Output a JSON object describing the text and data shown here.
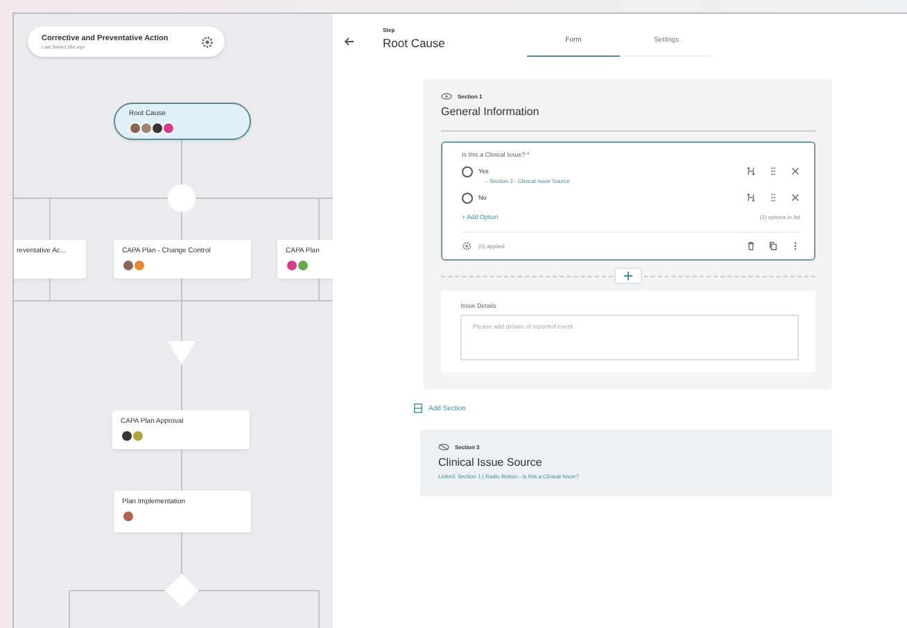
{
  "flow": {
    "title": "Corrective and Preventative Action",
    "subtitle": "Last Saved 18d ago",
    "nodes": [
      {
        "label": "Root Cause",
        "selected": true,
        "avatars": [
          {
            "color": "#8a6552"
          },
          {
            "color": "#9c8470"
          },
          {
            "color": "#3a3330"
          },
          {
            "color": "#d8398a"
          }
        ]
      },
      {
        "label": "reventative Ac...",
        "selected": false
      },
      {
        "label": "CAPA Plan - Change Control",
        "selected": false,
        "avatars": [
          {
            "color": "#8a6552"
          },
          {
            "color": "#e8892c"
          }
        ]
      },
      {
        "label": "CAPA Plan",
        "selected": false,
        "avatars": [
          {
            "color": "#d8398a"
          },
          {
            "color": "#6aa84f"
          }
        ]
      },
      {
        "label": "CAPA Plan Approval",
        "selected": false,
        "avatars": [
          {
            "color": "#3a3330"
          },
          {
            "color": "#b5a53f"
          }
        ]
      },
      {
        "label": "Plan Implementation",
        "selected": false,
        "avatars": [
          {
            "color": "#b0644f"
          }
        ]
      }
    ]
  },
  "step": {
    "caption": "Step",
    "title": "Root Cause"
  },
  "tabs": [
    {
      "label": "Form",
      "selected": true
    },
    {
      "label": "Settings",
      "selected": false
    }
  ],
  "section1": {
    "caption": "Section 1",
    "title": "General Information",
    "question": {
      "label": "Is this a Clinical Issue? *",
      "options": [
        {
          "label": "Yes",
          "selected": false,
          "link": "→ Section 3 - Clinical Issue Source"
        },
        {
          "label": "No",
          "selected": false
        }
      ],
      "add_option": "+ Add Option",
      "options_count": "(2) options in list",
      "rules": "(0) applied"
    },
    "field": {
      "label": "Issue Details",
      "placeholder": "Please add details of reported event"
    }
  },
  "add_section": "Add Section",
  "section3": {
    "caption": "Section 3",
    "title": "Clinical Issue Source",
    "linked": "Linked: Section 1 | Radio Button - Is this a Clinical Issue?"
  }
}
